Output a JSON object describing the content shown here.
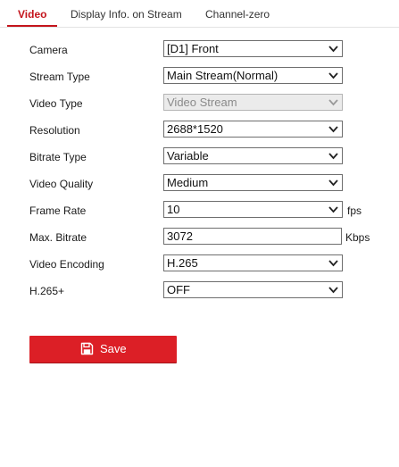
{
  "tabs": [
    {
      "label": "Video",
      "active": true
    },
    {
      "label": "Display Info. on Stream",
      "active": false
    },
    {
      "label": "Channel-zero",
      "active": false
    }
  ],
  "form": {
    "camera": {
      "label": "Camera",
      "value": "[D1] Front"
    },
    "stream_type": {
      "label": "Stream Type",
      "value": "Main Stream(Normal)"
    },
    "video_type": {
      "label": "Video Type",
      "value": "Video Stream",
      "disabled": true
    },
    "resolution": {
      "label": "Resolution",
      "value": "2688*1520"
    },
    "bitrate_type": {
      "label": "Bitrate Type",
      "value": "Variable"
    },
    "video_quality": {
      "label": "Video Quality",
      "value": "Medium"
    },
    "frame_rate": {
      "label": "Frame Rate",
      "value": "10",
      "unit": "fps"
    },
    "max_bitrate": {
      "label": "Max. Bitrate",
      "value": "3072",
      "unit": "Kbps"
    },
    "video_encoding": {
      "label": "Video Encoding",
      "value": "H.265"
    },
    "h265_plus": {
      "label": "H.265+",
      "value": "OFF"
    }
  },
  "save": {
    "label": "Save",
    "icon": "save-icon"
  },
  "colors": {
    "accent": "#c4141c",
    "save_button": "#dc1f26",
    "disabled_field": "#ebebeb"
  }
}
